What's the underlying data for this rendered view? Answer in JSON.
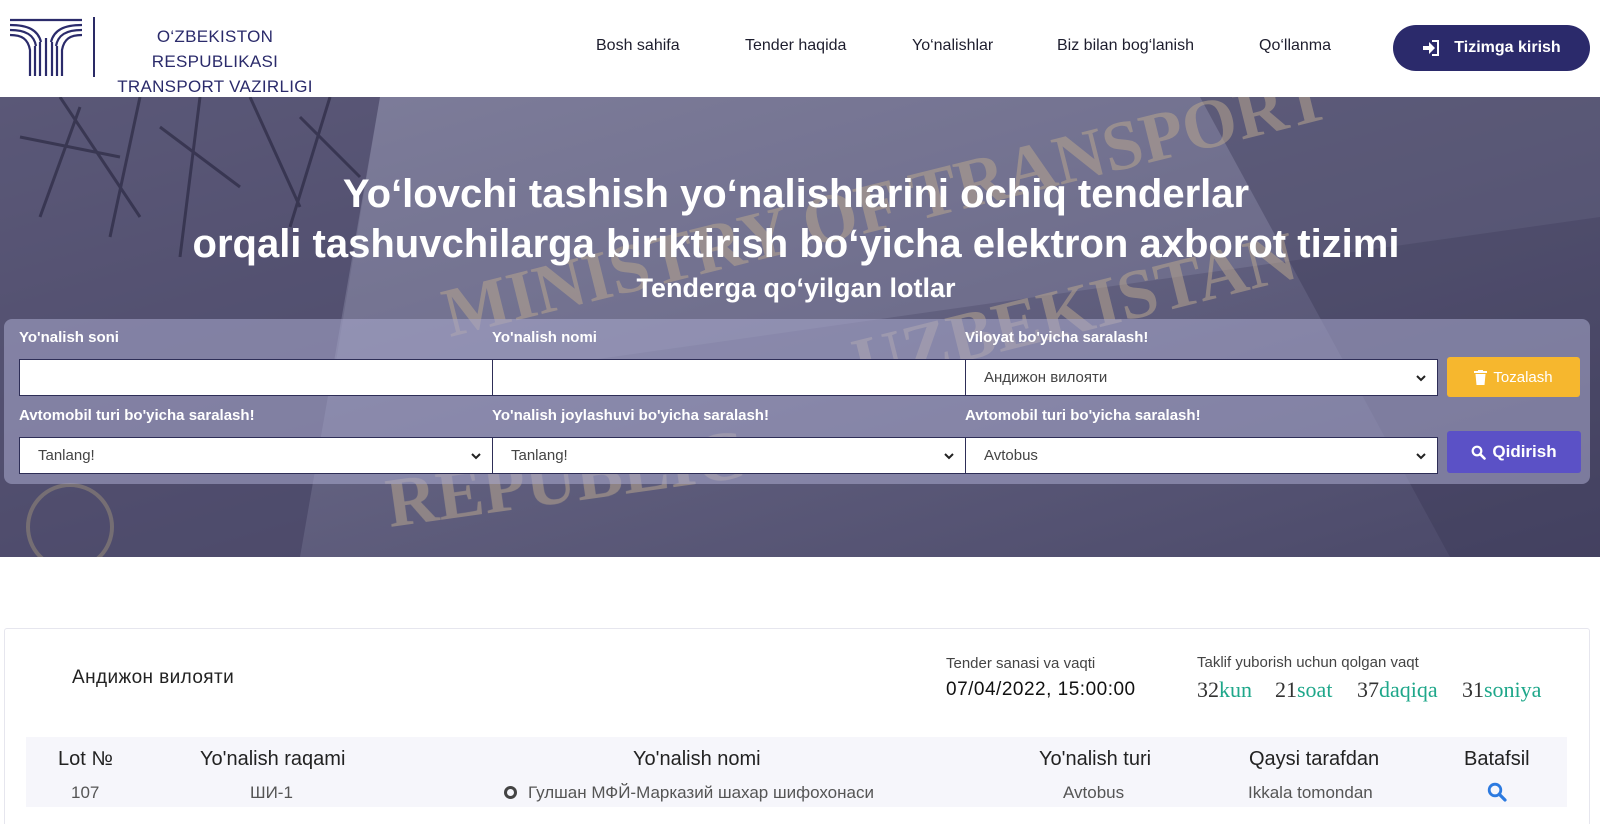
{
  "header": {
    "logo_text_line1": "O‘ZBEKISTON RESPUBLIKASI",
    "logo_text_line2": "TRANSPORT VAZIRLIGI",
    "nav": [
      "Bosh sahifa",
      "Tender haqida",
      "Yo‘nalishlar",
      "Biz bilan bog‘lanish",
      "Qo‘llanma"
    ],
    "login_label": "Tizimga kirish",
    "login_icon": "sign-in-icon"
  },
  "hero": {
    "title_line1": "Yo‘lovchi tashish yo‘nalishlarini ochiq tenderlar",
    "title_line2": "orqali tashuvchilarga biriktirish bo‘yicha elektron axborot tizimi",
    "subtitle": "Tenderga qo‘yilgan lotlar",
    "background_text": [
      "MINISTRY OF TRANSPORT",
      "UZBEKISTAN",
      "REPUBLIC"
    ]
  },
  "filters": {
    "route_number_label": "Yo'nalish soni",
    "route_number_value": "",
    "route_name_label": "Yo'nalish nomi",
    "route_name_value": "",
    "region_label": "Viloyat bo'yicha saralash!",
    "region_value": "Андижон вилояти",
    "vehicle_type_label": "Avtomobil turi bo'yicha saralash!",
    "vehicle_type_value": "Tanlang!",
    "route_location_label": "Yo'nalish joylashuvi bo'yicha saralash!",
    "route_location_value": "Tanlang!",
    "vehicle_type2_label": "Avtomobil turi bo'yicha saralash!",
    "vehicle_type2_value": "Avtobus",
    "clear_label": "Tozalash",
    "search_label": "Qidirish"
  },
  "lot": {
    "region": "Андижон вилояти",
    "tender_datetime_label": "Tender sanasi va vaqti",
    "tender_datetime": "07/04/2022, 15:00:00",
    "countdown_label": "Taklif yuborish uchun qolgan vaqt",
    "countdown": {
      "days": "32",
      "days_unit": "kun",
      "hours": "21",
      "hours_unit": "soat",
      "minutes": "37",
      "minutes_unit": "daqiqa",
      "seconds": "31",
      "seconds_unit": "soniya"
    },
    "columns": [
      "Lot №",
      "Yo'nalish raqami",
      "Yo'nalish nomi",
      "Yo'nalish turi",
      "Qaysi tarafdan",
      "Batafsil"
    ],
    "rows": [
      {
        "lot_no": "107",
        "route_number": "ШИ-1",
        "route_name": "Гулшан МФЙ-Марказий шахар шифохонаси",
        "route_type": "Avtobus",
        "direction": "Ikkala tomondan",
        "details_icon": "search-icon"
      }
    ]
  },
  "colors": {
    "brand": "#2b2a6b",
    "clear_button": "#f6b72e",
    "search_button": "#5b51c6",
    "countdown_unit": "#1ea78a"
  }
}
